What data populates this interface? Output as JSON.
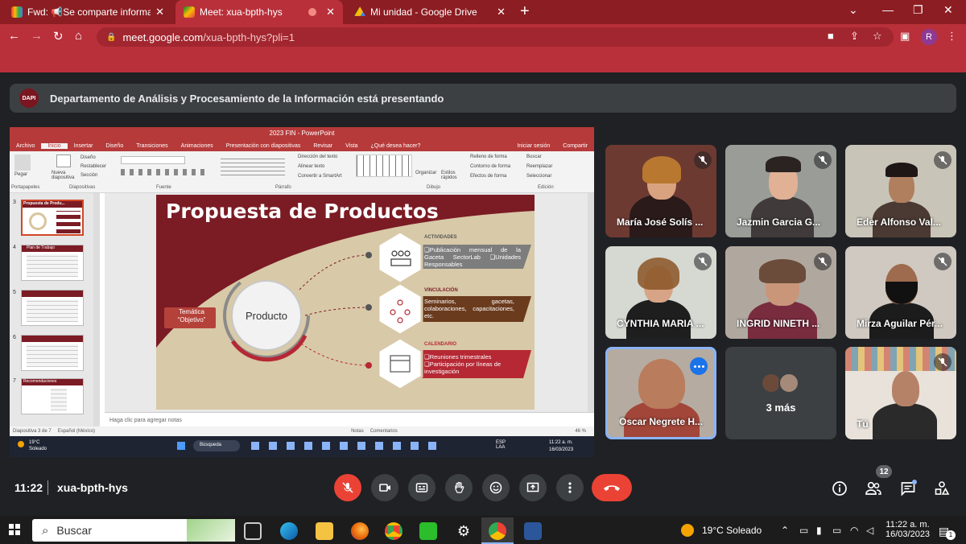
{
  "browser": {
    "tabs": [
      {
        "label": "Fwd: 📢Se comparte informació",
        "icon": "gmail-icon"
      },
      {
        "label": "Meet: xua-bpth-hys",
        "icon": "meet-icon"
      },
      {
        "label": "Mi unidad - Google Drive",
        "icon": "drive-icon"
      }
    ],
    "url_domain": "meet.google.com",
    "url_path": "/xua-bpth-hys?pli=1",
    "profile_letter": "R"
  },
  "banner": {
    "logo": "DAPI",
    "text": "Departamento de Análisis y Procesamiento de la Información está presentando"
  },
  "powerpoint": {
    "title": "2023 FIN  -  PowerPoint",
    "ribbon_tabs": [
      "Archivo",
      "Inicio",
      "Insertar",
      "Diseño",
      "Transiciones",
      "Animaciones",
      "Presentación con diapositivas",
      "Revisar",
      "Vista",
      "¿Qué desea hacer?"
    ],
    "account": "Iniciar sesión",
    "share": "Compartir",
    "groups": [
      "Portapapeles",
      "Diapositivas",
      "Fuente",
      "Párrafo",
      "Dibujo",
      "Edición"
    ],
    "ribbon_items": {
      "paste": "Pegar",
      "new_slide": "Nueva diapositiva",
      "layout": "Diseño",
      "reset": "Restablecer",
      "section": "Sección",
      "text_dir": "Dirección del texto",
      "align_text": "Alinear texto",
      "smartart": "Convertir a SmartArt",
      "arrange": "Organizar",
      "quick_styles": "Estilos rápidos",
      "fill": "Relleno de forma",
      "outline": "Contorno de forma",
      "effects": "Efectos de forma",
      "find": "Buscar",
      "replace": "Reemplazar",
      "select": "Seleccionar"
    },
    "thumbs": [
      {
        "n": "3",
        "title": "Propuesta de Produ..."
      },
      {
        "n": "4",
        "title": "Plan de Trabajo"
      },
      {
        "n": "5",
        "title": ""
      },
      {
        "n": "6",
        "title": ""
      },
      {
        "n": "7",
        "title": "Recomendaciones"
      }
    ],
    "slide": {
      "title": "Propuesta de Productos",
      "tematica": "Temática “Objetivo”",
      "center": "Producto",
      "items": [
        {
          "heading": "ACTIVIDADES",
          "text": "❑Publicación mensual de la Gaceta SectorLab ❑Unidades Responsables"
        },
        {
          "heading": "VINCULACIÓN",
          "text": "Seminarios, gacetas, colaboraciones, capacitaciones, etc."
        },
        {
          "heading": "CALENDARIO",
          "text": "❑Reuniones trimestrales ❑Participación por líneas de investigación"
        }
      ]
    },
    "notes": "Haga clic para agregar notas",
    "status": {
      "slide": "Diapositiva 3 de 7",
      "lang": "Español (México)",
      "notes": "Notas",
      "comments": "Comentarios",
      "zoom": "46 %"
    },
    "inner_taskbar": {
      "weather_temp": "19°C",
      "weather": "Soleado",
      "search": "Búsqueda",
      "lang": "ESP LAA",
      "time": "11:22 a. m.",
      "date": "16/03/2023"
    }
  },
  "participants": [
    {
      "name": "María José Solís ...",
      "muted": true
    },
    {
      "name": "Jazmin Garcia G...",
      "muted": true
    },
    {
      "name": "Eder Alfonso Val...",
      "muted": true
    },
    {
      "name": "CYNTHIA MARIA ...",
      "muted": true
    },
    {
      "name": "INGRID NINETH ...",
      "muted": true
    },
    {
      "name": "Mirza Aguilar Pér...",
      "muted": true
    },
    {
      "name": "Oscar Negrete H...",
      "muted": false
    },
    {
      "name": "3 más",
      "muted": false
    },
    {
      "name": "Tú",
      "muted": true
    }
  ],
  "controls": {
    "time": "11:22",
    "code": "xua-bpth-hys",
    "people_count": "12"
  },
  "taskbar": {
    "search": "Buscar",
    "weather": "19°C  Soleado",
    "time": "11:22 a. m.",
    "date": "16/03/2023",
    "notif": "1"
  },
  "colors": {
    "chrome_red": "#b9303a",
    "meet_bg": "#202124",
    "slide_maroon": "#7b1b24",
    "end_call": "#ea4335"
  }
}
